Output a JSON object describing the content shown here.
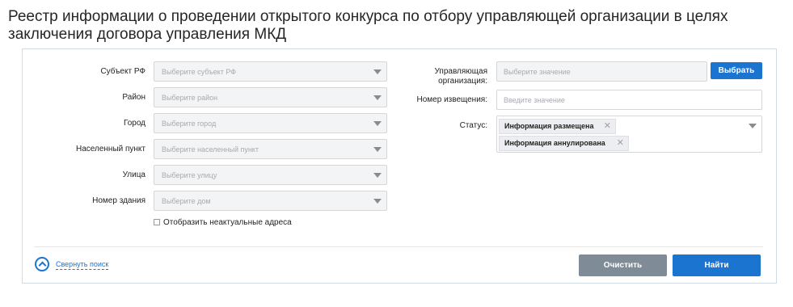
{
  "page_title": "Реестр информации о проведении открытого конкурса по отбору управляющей организации в целях заключения договора управления МКД",
  "left_fields": [
    {
      "label": "Субъект РФ",
      "placeholder": "Выберите субъект РФ"
    },
    {
      "label": "Район",
      "placeholder": "Выберите район"
    },
    {
      "label": "Город",
      "placeholder": "Выберите город"
    },
    {
      "label": "Населенный пункт",
      "placeholder": "Выберите населенный пункт"
    },
    {
      "label": "Улица",
      "placeholder": "Выберите улицу"
    },
    {
      "label": "Номер здания",
      "placeholder": "Выберите дом"
    }
  ],
  "checkbox": {
    "label": "Отобразить неактуальные адреса",
    "checked": false
  },
  "org": {
    "label_line1": "Управляющая",
    "label_line2": "организация:",
    "placeholder": "Выберите значение",
    "button": "Выбрать"
  },
  "notice": {
    "label": "Номер извещения:",
    "placeholder": "Введите значение"
  },
  "status": {
    "label": "Статус:",
    "tags": [
      "Информация размещена",
      "Информация аннулирована"
    ]
  },
  "footer": {
    "collapse": "Свернуть поиск",
    "clear": "Очистить",
    "find": "Найти"
  },
  "colors": {
    "accent": "#1b74d0",
    "clear_button": "#7f8b96"
  }
}
